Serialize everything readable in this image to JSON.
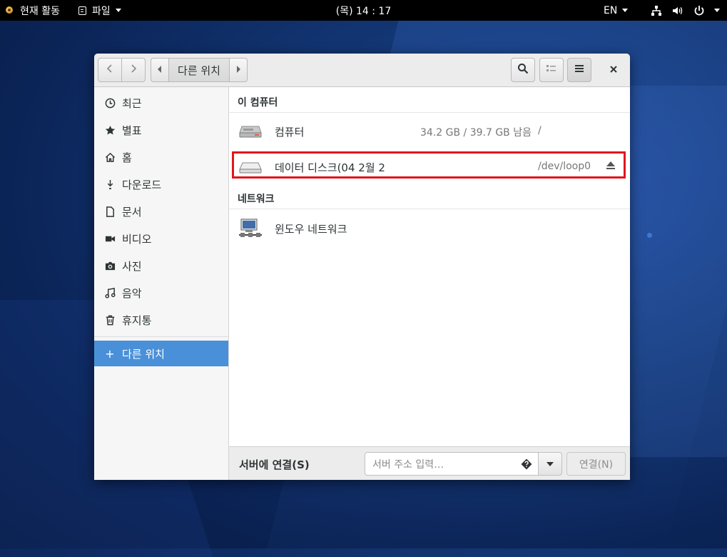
{
  "topbar": {
    "activities": "현재 활동",
    "app_menu": "파일",
    "clock": "(목) 14 : 17",
    "language": "EN"
  },
  "header": {
    "path_current": "다른 위치"
  },
  "sidebar": {
    "items": [
      {
        "label": "최근",
        "icon": "clock-icon"
      },
      {
        "label": "별표",
        "icon": "star-icon"
      },
      {
        "label": "홈",
        "icon": "home-icon"
      },
      {
        "label": "다운로드",
        "icon": "download-icon"
      },
      {
        "label": "문서",
        "icon": "document-icon"
      },
      {
        "label": "비디오",
        "icon": "video-icon"
      },
      {
        "label": "사진",
        "icon": "camera-icon"
      },
      {
        "label": "음악",
        "icon": "music-icon"
      },
      {
        "label": "휴지통",
        "icon": "trash-icon"
      }
    ],
    "other_locations": "다른 위치"
  },
  "main": {
    "this_computer_title": "이 컴퓨터",
    "computer": {
      "name": "컴퓨터",
      "space": "34.2 GB / 39.7 GB 남음",
      "mount": "/"
    },
    "data_disk": {
      "name": "데이터 디스크(04  2월 2",
      "mount": "/dev/loop0"
    },
    "network_title": "네트워크",
    "windows_network": {
      "name": "윈도우 네트워크"
    }
  },
  "bottom": {
    "connect_label": "서버에 연결(S)",
    "address_placeholder": "서버 주소 입력…",
    "connect_button": "연결(N)"
  },
  "colors": {
    "accent": "#4a90d9",
    "highlight_border": "#e0161e",
    "topbar": "#000000"
  }
}
